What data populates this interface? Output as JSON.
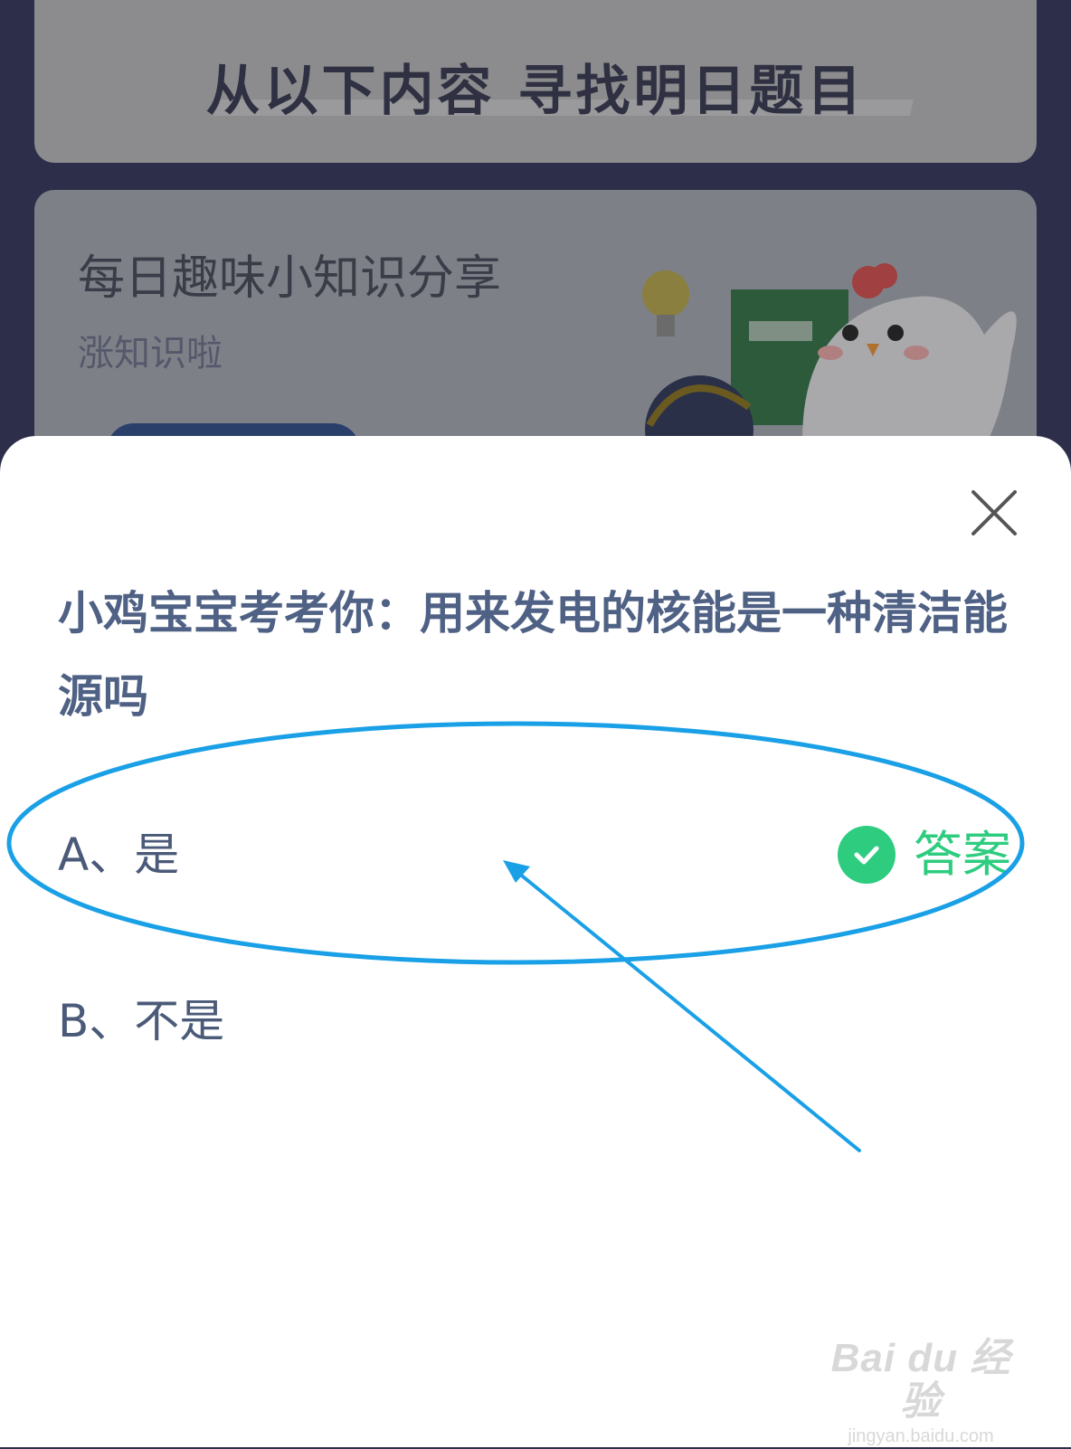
{
  "background": {
    "header_title": "从以下内容  寻找明日题目",
    "card_title": "每日趣味小知识分享",
    "card_subtitle": "涨知识啦"
  },
  "modal": {
    "question": "小鸡宝宝考考你：用来发电的核能是一种清洁能源吗",
    "options": [
      {
        "label": "A、是",
        "is_answer": true
      },
      {
        "label": "B、不是",
        "is_answer": false
      }
    ],
    "answer_label": "答案",
    "close_icon": "close-icon",
    "answer_icon": "check-circle-icon"
  },
  "annotation": {
    "color": "#1aa0e6",
    "shapes": [
      "ellipse",
      "arrow"
    ]
  },
  "watermark": {
    "brand": "Bai du 经验",
    "url": "jingyan.baidu.com"
  },
  "colors": {
    "question_text": "#4f6184",
    "option_text": "#4a5a78",
    "answer_green": "#2ecc7f"
  }
}
